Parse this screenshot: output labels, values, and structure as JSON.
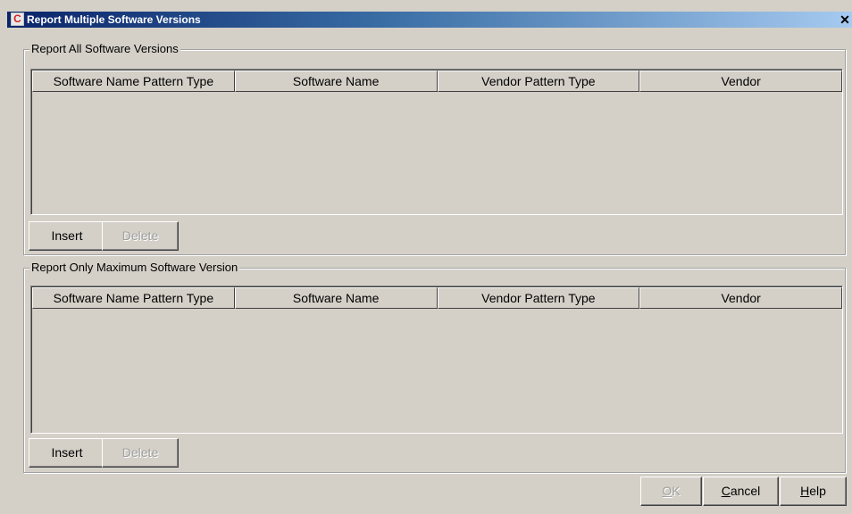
{
  "window": {
    "title": "Report Multiple Software Versions",
    "app_icon_glyph": "C",
    "close_glyph": "✕"
  },
  "sections": [
    {
      "legend": "Report All Software Versions",
      "columns": [
        "Software Name Pattern Type",
        "Software Name",
        "Vendor Pattern Type",
        "Vendor"
      ],
      "rows": [],
      "insert_label": "Insert",
      "delete_label": "Delete"
    },
    {
      "legend": "Report Only Maximum Software Version",
      "columns": [
        "Software Name Pattern Type",
        "Software Name",
        "Vendor Pattern Type",
        "Vendor"
      ],
      "rows": [],
      "insert_label": "Insert",
      "delete_label": "Delete"
    }
  ],
  "footer": {
    "ok_mnemonic": "O",
    "ok_rest": "K",
    "cancel_mnemonic": "C",
    "cancel_rest": "ancel",
    "help_mnemonic": "H",
    "help_rest": "elp"
  },
  "colors": {
    "dialog_bg": "#d4d0c8",
    "title_gradient_start": "#0a246a",
    "title_gradient_end": "#a6caf0",
    "disabled_text": "#a0a0a0"
  }
}
